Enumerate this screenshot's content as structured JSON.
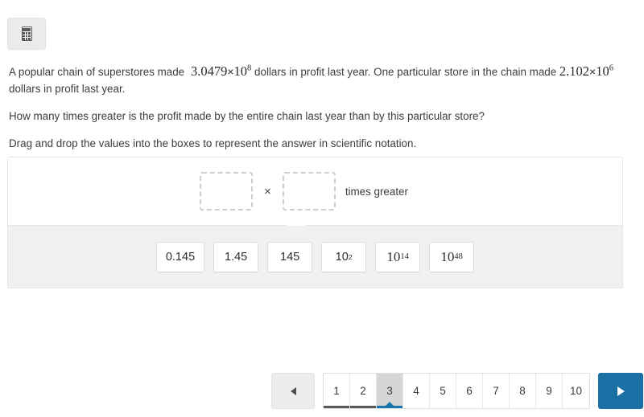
{
  "toolbar": {
    "calculator_label": "Calculator",
    "calculator_icon": "calculator-icon"
  },
  "question": {
    "stem_part1": "A popular chain of superstores made",
    "stem_math1": {
      "mantissa": "3.0479",
      "times": "×",
      "base": "10",
      "exponent": "8"
    },
    "stem_part2": "dollars in profit last year. One particular store in the chain made",
    "stem_math2": {
      "mantissa": "2.102",
      "times": "×",
      "base": "10",
      "exponent": "6"
    },
    "stem_part3": "dollars in profit last year.",
    "ask": "How many times greater is the profit made by the entire chain last year than by this particular store?",
    "instruction": "Drag and drop the values into the boxes to represent the answer in scientific notation."
  },
  "activity": {
    "dropboxes": [
      {
        "name": "mantissa-dropbox",
        "value": ""
      },
      {
        "name": "exponent-dropbox",
        "value": ""
      }
    ],
    "operator": "×",
    "suffix_label": "times greater",
    "tiles": [
      {
        "label": "0.145",
        "kind": "plain"
      },
      {
        "label": "1.45",
        "kind": "plain"
      },
      {
        "label": "145",
        "kind": "plain"
      },
      {
        "base": "10",
        "exponent": "2",
        "kind": "power-small"
      },
      {
        "base": "10",
        "exponent": "14",
        "kind": "power"
      },
      {
        "base": "10",
        "exponent": "48",
        "kind": "power"
      }
    ]
  },
  "pagination": {
    "prev_label": "◄",
    "next_label": "►",
    "current_page": 3,
    "pages": [
      "1",
      "2",
      "3",
      "4",
      "5",
      "6",
      "7",
      "8",
      "9",
      "10"
    ],
    "visited_pages": [
      "1",
      "2"
    ],
    "accent_color": "#1a74ad",
    "visited_color": "#585858",
    "current_bg": "#d6d6d6"
  }
}
